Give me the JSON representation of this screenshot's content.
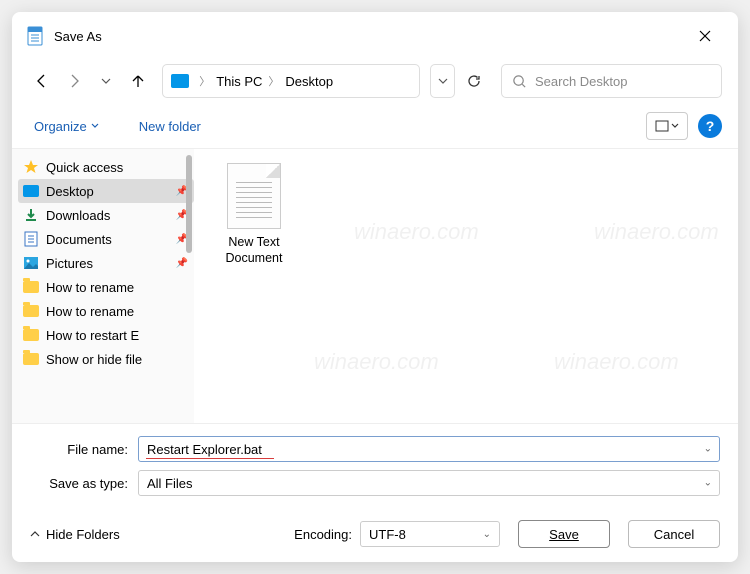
{
  "window": {
    "title": "Save As"
  },
  "nav": {
    "crumbs": {
      "thispc": "This PC",
      "desktop": "Desktop"
    },
    "search_placeholder": "Search Desktop"
  },
  "toolbar": {
    "organize": "Organize",
    "newfolder": "New folder",
    "help": "?"
  },
  "sidebar": {
    "items": [
      {
        "label": "Quick access",
        "icon": "star",
        "pinned": false
      },
      {
        "label": "Desktop",
        "icon": "desktop",
        "pinned": true,
        "selected": true
      },
      {
        "label": "Downloads",
        "icon": "downloads",
        "pinned": true
      },
      {
        "label": "Documents",
        "icon": "documents",
        "pinned": true
      },
      {
        "label": "Pictures",
        "icon": "pictures",
        "pinned": true
      },
      {
        "label": "How to rename",
        "icon": "folder",
        "pinned": false
      },
      {
        "label": "How to rename",
        "icon": "folder",
        "pinned": false
      },
      {
        "label": "How to restart E",
        "icon": "folder",
        "pinned": false
      },
      {
        "label": "Show or hide file",
        "icon": "folder",
        "pinned": false
      }
    ]
  },
  "files": [
    {
      "name": "New Text Document"
    }
  ],
  "form": {
    "filename_label": "File name:",
    "filename_value": "Restart Explorer.bat",
    "saveastype_label": "Save as type:",
    "saveastype_value": "All Files",
    "encoding_label": "Encoding:",
    "encoding_value": "UTF-8",
    "hide_folders": "Hide Folders",
    "save": "Save",
    "cancel": "Cancel"
  }
}
